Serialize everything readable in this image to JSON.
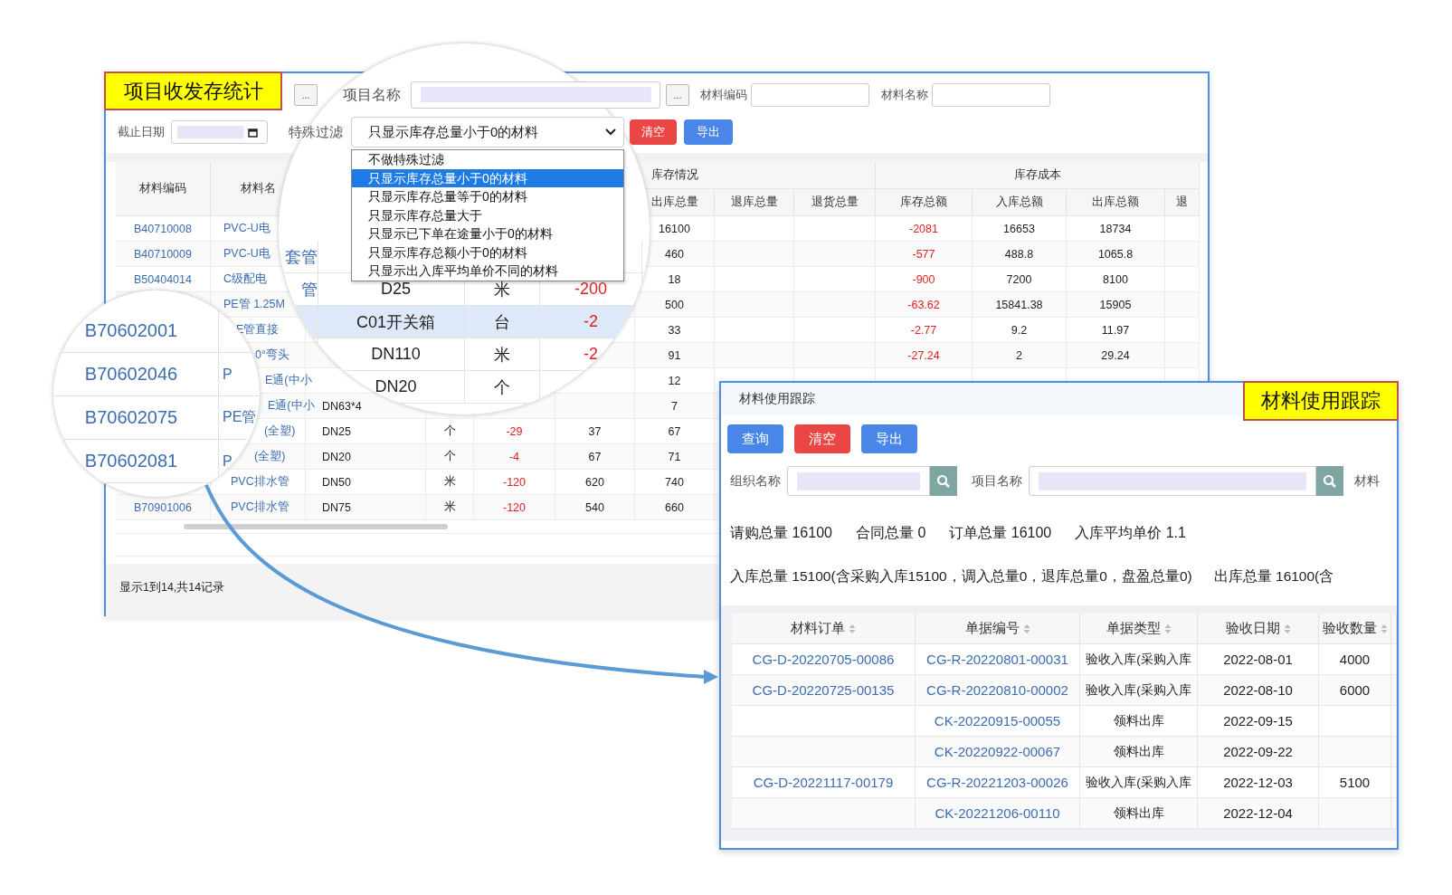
{
  "stock_window": {
    "badge": "项目收发存统计",
    "toolbar": {
      "left_picker_button": "...",
      "project_label": "项目名称",
      "project_picker_button": "...",
      "code_label": "材料编码",
      "name_label": "材料名称",
      "date_label": "截止日期",
      "special_label": "特殊过滤"
    },
    "special_filter": {
      "value": "只显示库存总量小于0的材料",
      "expanded": true,
      "options": [
        {
          "label": "不做特殊过滤",
          "selected": false
        },
        {
          "label": "只显示库存总量小于0的材料",
          "selected": true
        },
        {
          "label": "只显示库存总量等于0的材料",
          "selected": false
        },
        {
          "label": "只显示库存总量大于",
          "selected": false
        },
        {
          "label": "只显示已下单在途量小于0的材料",
          "selected": false
        },
        {
          "label": "只显示库存总额小于0的材料",
          "selected": false
        },
        {
          "label": "只显示出入库平均单价不同的材料",
          "selected": false
        }
      ]
    },
    "buttons": [
      {
        "label": "清空",
        "kind": "danger"
      },
      {
        "label": "导出",
        "kind": "primary"
      }
    ],
    "table": {
      "group_headers": [
        "库存情况",
        "库存成本"
      ],
      "columns": [
        {
          "label": "材料编码",
          "kind": "link"
        },
        {
          "label": "材料名",
          "kind": "link"
        },
        {
          "kind": "plain"
        },
        {
          "kind": "plain"
        },
        {
          "kind": "negative"
        },
        {
          "kind": "plain"
        },
        {
          "label": "出库总量",
          "kind": "plain"
        },
        {
          "label": "退库总量",
          "kind": "plain"
        },
        {
          "label": "退货总量",
          "kind": "plain"
        },
        {
          "label": "库存总额",
          "kind": "negative"
        },
        {
          "label": "入库总额",
          "kind": "plain"
        },
        {
          "label": "出库总额",
          "kind": "plain"
        },
        {
          "label": "退",
          "kind": "plain"
        }
      ],
      "rows": [
        [
          "B40710008",
          "PVC-U电",
          null,
          null,
          null,
          null,
          "16100",
          null,
          null,
          "-2081",
          "16653",
          "18734",
          null
        ],
        [
          "B40710009",
          "PVC-U电",
          null,
          null,
          null,
          null,
          "460",
          null,
          null,
          "-577",
          "488.8",
          "1065.8",
          null
        ],
        [
          "B50404014",
          "C级配电",
          null,
          null,
          null,
          null,
          "18",
          null,
          null,
          "-900",
          "7200",
          "8100",
          null
        ],
        [
          null,
          "PE管 1.25M",
          null,
          null,
          null,
          null,
          "500",
          null,
          null,
          "-63.62",
          "15841.38",
          "15905",
          null
        ],
        [
          null,
          "E管直接",
          null,
          null,
          null,
          null,
          "33",
          null,
          null,
          "-2.77",
          "9.2",
          "11.97",
          null
        ],
        [
          null,
          "0°弯头",
          null,
          null,
          null,
          null,
          "91",
          null,
          null,
          "-27.24",
          "2",
          "29.24",
          null
        ],
        [
          null,
          "E通(中小",
          null,
          null,
          null,
          null,
          "12",
          null,
          null,
          null,
          null,
          null,
          null
        ],
        [
          null,
          "E通(中小",
          "DN63*4",
          null,
          null,
          null,
          "7",
          null,
          null,
          null,
          null,
          null,
          null
        ],
        [
          null,
          "(全塑)",
          "DN25",
          "个",
          "-29",
          "37",
          "67",
          null,
          null,
          null,
          null,
          null,
          null
        ],
        [
          null,
          "(全塑)",
          "DN20",
          "个",
          "-4",
          "67",
          "71",
          null,
          null,
          null,
          null,
          null,
          null
        ],
        [
          null,
          "PVC排水管",
          "DN50",
          "米",
          "-120",
          "620",
          "740",
          null,
          null,
          null,
          null,
          null,
          null
        ],
        [
          "B70901006",
          "PVC排水管",
          "DN75",
          "米",
          "-120",
          "540",
          "660",
          null,
          null,
          null,
          null,
          null,
          null
        ]
      ],
      "footer": "显示1到14,共14记录"
    },
    "magnifier_large": {
      "rows": [
        {
          "name": "套管",
          "selected": false
        },
        {
          "name": "管",
          "spec": "D25",
          "unit": "米",
          "qty": "-200",
          "selected": false
        },
        {
          "spec": "C01开关箱",
          "unit": "台",
          "qty": "-2",
          "selected": true
        },
        {
          "spec": "DN110",
          "unit": "米",
          "qty": "-2",
          "selected": false
        },
        {
          "spec": "DN20",
          "unit": "个",
          "selected": false
        }
      ]
    },
    "magnifier_small": {
      "rows": [
        {
          "code": "B70602001"
        },
        {
          "code": "B70602046",
          "name": "P"
        },
        {
          "code": "B70602075",
          "name": "PE管"
        },
        {
          "code": "B70602081",
          "name": "P"
        }
      ]
    }
  },
  "tracking_window": {
    "title": "材料使用跟踪",
    "badge": "材料使用跟踪",
    "buttons": [
      {
        "label": "查询",
        "kind": "primary"
      },
      {
        "label": "清空",
        "kind": "danger"
      },
      {
        "label": "导出",
        "kind": "primary"
      }
    ],
    "fields": [
      {
        "label": "组织名称",
        "kind": "short"
      },
      {
        "label": "项目名称",
        "kind": "long"
      }
    ],
    "cut_label": "材料",
    "summary_lines": [
      [
        "请购总量 16100",
        "合同总量 0",
        "订单总量 16100",
        "入库平均单价 1.1"
      ],
      [
        "入库总量 15100(含采购入库15100，调入总量0，退库总量0，盘盈总量0)",
        "出库总量 16100(含"
      ]
    ],
    "table": {
      "columns": [
        {
          "label": "材料订单",
          "kind": "link"
        },
        {
          "label": "单据编号",
          "kind": "link"
        },
        {
          "label": "单据类型",
          "kind": "small"
        },
        {
          "label": "验收日期",
          "kind": "plain"
        },
        {
          "label": "验收数量",
          "kind": "plain"
        }
      ],
      "rows": [
        [
          "CG-D-20220705-00086",
          "CG-R-20220801-00031",
          "验收入库(采购入库",
          "2022-08-01",
          "4000"
        ],
        [
          "CG-D-20220725-00135",
          "CG-R-20220810-00002",
          "验收入库(采购入库",
          "2022-08-10",
          "6000"
        ],
        [
          null,
          "CK-20220915-00055",
          "领料出库",
          "2022-09-15",
          null
        ],
        [
          null,
          "CK-20220922-00067",
          "领料出库",
          "2022-09-22",
          null
        ],
        [
          "CG-D-20221117-00179",
          "CG-R-20221203-00026",
          "验收入库(采购入库",
          "2022-12-03",
          "5100"
        ],
        [
          null,
          "CK-20221206-00110",
          "领料出库",
          "2022-12-04",
          null
        ]
      ]
    }
  }
}
